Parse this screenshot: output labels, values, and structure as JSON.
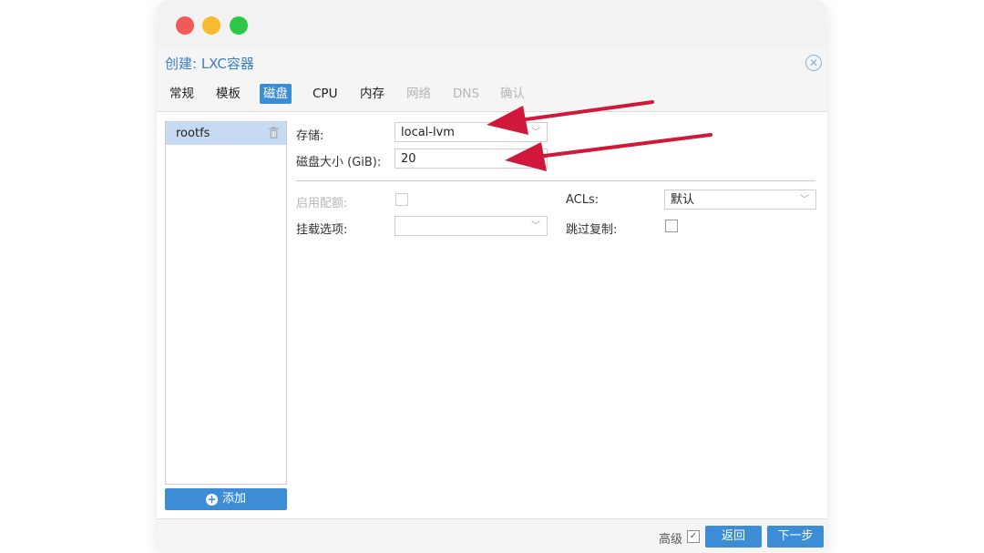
{
  "dialog": {
    "title": "创建: LXC容器",
    "tabs": [
      {
        "label": "常规",
        "state": "normal"
      },
      {
        "label": "模板",
        "state": "normal"
      },
      {
        "label": "磁盘",
        "state": "active"
      },
      {
        "label": "CPU",
        "state": "normal"
      },
      {
        "label": "内存",
        "state": "normal"
      },
      {
        "label": "网络",
        "state": "disabled"
      },
      {
        "label": "DNS",
        "state": "disabled"
      },
      {
        "label": "确认",
        "state": "disabled"
      }
    ]
  },
  "mountpoints": {
    "items": [
      {
        "label": "rootfs"
      }
    ],
    "add_label": "添加"
  },
  "form": {
    "storage_label": "存储:",
    "storage_value": "local-lvm",
    "disksize_label": "磁盘大小 (GiB):",
    "disksize_value": "20",
    "quota_label": "启用配额:",
    "acls_label": "ACLs:",
    "acls_value": "默认",
    "mountoptions_label": "挂载选项:",
    "mountoptions_value": "",
    "skipreplication_label": "跳过复制:"
  },
  "footer": {
    "advanced_label": "高级",
    "back_label": "返回",
    "next_label": "下一步"
  },
  "colors": {
    "accent": "#3c8dd6",
    "title": "#3c80c6",
    "annotation_arrow": "#d0183a"
  }
}
